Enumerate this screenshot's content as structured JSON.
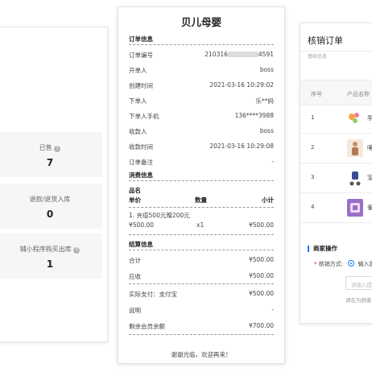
{
  "left_stats": [
    {
      "label": "已售",
      "value": "7",
      "help_icon": "question-circle-icon"
    },
    {
      "label": "退款/退货入库",
      "value": "0",
      "help_icon": ""
    },
    {
      "label": "辅小程序购买出库",
      "value": "1",
      "help_icon": "question-circle-icon"
    }
  ],
  "receipt": {
    "title": "贝儿母婴",
    "order_section": "订单信息",
    "order_rows": [
      {
        "key": "订单编号",
        "value_prefix": "210316",
        "value_suffix": "4591"
      },
      {
        "key": "开单人",
        "value": "boss"
      },
      {
        "key": "创建时间",
        "value": "2021-03-16 10:29:02"
      },
      {
        "key": "下单人",
        "value": "乐**妈"
      },
      {
        "key": "下单人手机",
        "value": "136****3988"
      },
      {
        "key": "收款人",
        "value": "boss"
      },
      {
        "key": "收款时间",
        "value": "2021-03-16 10:29:08"
      },
      {
        "key": "订单备注",
        "value": "-"
      }
    ],
    "consume_section": "消费信息",
    "item_headers": {
      "name": "品名",
      "price": "单价",
      "qty": "数量",
      "subtotal": "小计"
    },
    "items": [
      {
        "name": "1. 充值500元赠200元",
        "price": "¥500.00",
        "qty": "x1",
        "subtotal": "¥500.00"
      }
    ],
    "settle_section": "结算信息",
    "settle_rows": [
      {
        "key": "合计",
        "value": "¥500.00"
      },
      {
        "key": "应收",
        "value": "¥500.00"
      }
    ],
    "pay_rows": [
      {
        "key": "实际支付：支付宝",
        "value": "¥500.00"
      },
      {
        "key": "说明",
        "value": "-"
      },
      {
        "key": "剩余会员余额",
        "value": "¥700.00"
      }
    ],
    "footer": "谢谢光临，欢迎再来！"
  },
  "right_panel": {
    "title": "核销订单",
    "subtitle": "基础信息",
    "headers": {
      "num": "序号",
      "product": "产品名称"
    },
    "rows": [
      {
        "num": "1",
        "name": "孕",
        "thumb_color": "#f3a64a"
      },
      {
        "num": "2",
        "name": "哺",
        "thumb_color": "#c98f63"
      },
      {
        "num": "3",
        "name": "宝",
        "thumb_color": "#3a4f8f"
      },
      {
        "num": "4",
        "name": "雀",
        "thumb_color": "#9b6fc7"
      }
    ],
    "op_section": "商家操作",
    "method_label": "核销方式:",
    "method_option": "输入提",
    "input_placeholder": "请输入提货码",
    "hint": "请在为顾客"
  }
}
